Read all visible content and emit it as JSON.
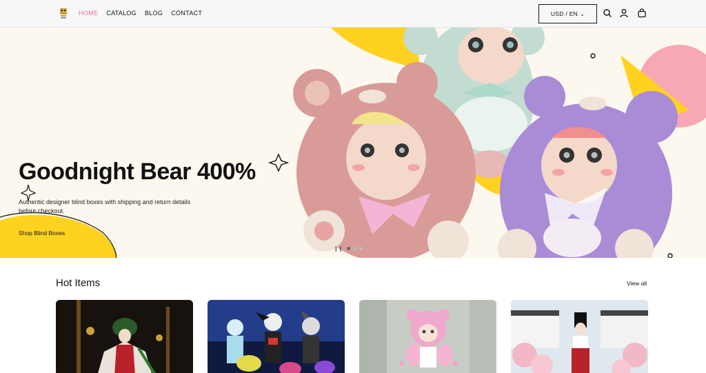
{
  "header": {
    "logo_alt": "logo",
    "nav": [
      {
        "label": "HOME"
      },
      {
        "label": "CATALOG"
      },
      {
        "label": "BLOG"
      },
      {
        "label": "CONTACT"
      }
    ],
    "currency_selector": "USD / EN",
    "icons": [
      "search-icon",
      "account-icon",
      "cart-icon"
    ]
  },
  "hero": {
    "title": "Goodnight Bear 400%",
    "description": "Authentic designer blind boxes with shipping and return details before checkout.",
    "cta": "Shop Blind Boxes",
    "slides_total": 3,
    "slide_active": 1,
    "colors": {
      "background": "#fcf8ef",
      "yellow": "#ffd21f",
      "pink": "#f7a8b4",
      "bear_pink": "#d99b98",
      "bear_mint": "#c3dcd1",
      "bear_purple": "#a98bd6"
    }
  },
  "hot_items": {
    "title": "Hot Items",
    "view_all": "View all",
    "cards": [
      {
        "image": "product-image-1"
      },
      {
        "image": "product-image-2"
      },
      {
        "image": "product-image-3"
      },
      {
        "image": "product-image-4"
      }
    ]
  },
  "colors": {
    "accent": "#e8708e",
    "text": "#111111"
  }
}
